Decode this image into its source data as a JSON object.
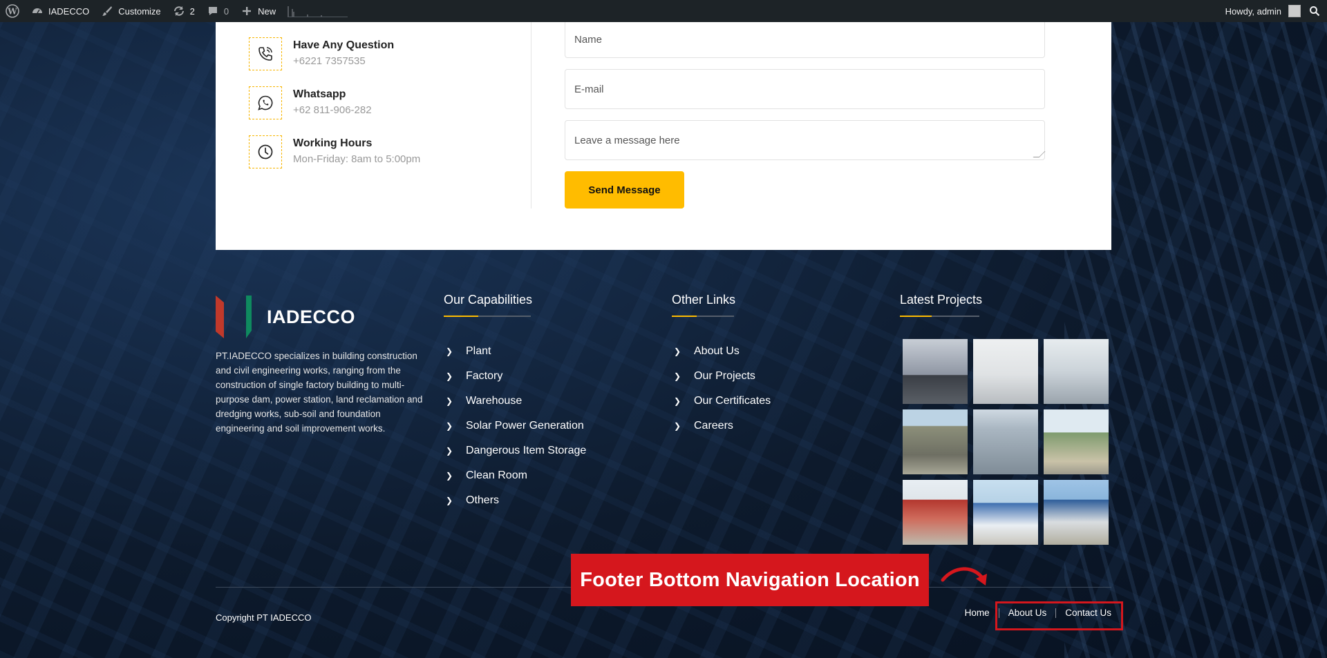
{
  "admin_bar": {
    "site_name": "IADECCO",
    "customize": "Customize",
    "updates_count": "2",
    "comments_count": "0",
    "new_label": "New",
    "greeting": "Howdy, admin"
  },
  "contact": {
    "items": [
      {
        "title": "Have Any Question",
        "value": "+6221 7357535",
        "icon": "phone-icon"
      },
      {
        "title": "Whatsapp",
        "value": "+62 811-906-282",
        "icon": "whatsapp-icon"
      },
      {
        "title": "Working Hours",
        "value": "Mon-Friday: 8am to 5:00pm",
        "icon": "clock-icon"
      }
    ],
    "form": {
      "name_placeholder": "Name",
      "email_placeholder": "E-mail",
      "message_placeholder": "Leave a message here",
      "send_label": "Send Message"
    }
  },
  "footer": {
    "brand_name": "IADECCO",
    "description": "PT.IADECCO specializes in building construction and civil engineering works, ranging from the construction of single factory building to multi-purpose dam, power station, land reclamation and dredging works, sub-soil and foundation engineering and soil improvement works.",
    "capabilities": {
      "title": "Our Capabilities",
      "items": [
        "Plant",
        "Factory",
        "Warehouse",
        "Solar Power Generation",
        "Dangerous Item Storage",
        "Clean Room",
        "Others"
      ]
    },
    "other_links": {
      "title": "Other Links",
      "items": [
        "About Us",
        "Our Projects",
        "Our Certificates",
        "Careers"
      ]
    },
    "latest_projects": {
      "title": "Latest Projects"
    },
    "copyright": "Copyright PT IADECCO",
    "bottom_nav": [
      "Home",
      "About Us",
      "Contact Us"
    ]
  },
  "annotation": {
    "label": "Footer Bottom Navigation Location",
    "color": "#d5171d"
  },
  "colors": {
    "accent": "#ffbc00",
    "admin_bar": "#1d2327"
  }
}
